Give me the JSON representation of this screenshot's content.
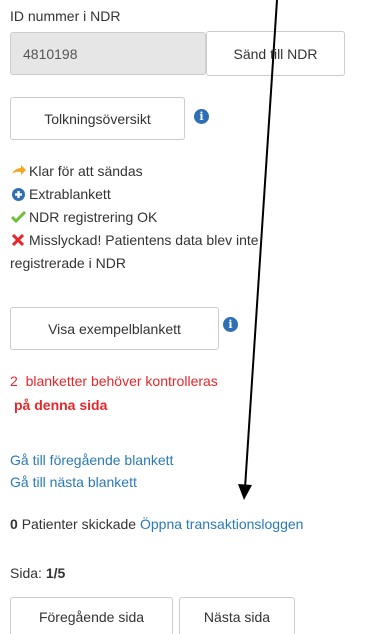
{
  "ndr": {
    "id_label": "ID nummer i NDR",
    "id_value": "4810198",
    "send_button": "Sänd till NDR"
  },
  "interpretation": {
    "button": "Tolkningsöversikt",
    "info_icon": "info-circle-icon"
  },
  "legend": {
    "ready": "Klar för att sändas",
    "extra": "Extrablankett",
    "ok": "NDR registrering OK",
    "failed_line1": "Misslyckad! Patientens data blev inte",
    "failed_line2": "registrerade i NDR"
  },
  "example": {
    "button": "Visa exempelblankett",
    "info_icon": "info-circle-icon"
  },
  "warning": {
    "count": "2",
    "line1_rest": "blanketter behöver kontrolleras",
    "line2": "på denna sida"
  },
  "navigation": {
    "prev_form": "Gå till föregående blankett",
    "next_form": "Gå till nästa blankett"
  },
  "transactions": {
    "count": "0",
    "sent_text": "Patienter skickade",
    "log_link": "Öppna transaktionsloggen"
  },
  "pagination": {
    "label": "Sida:",
    "value": "1/5",
    "prev_page": "Föregående sida",
    "next_page": "Nästa sida"
  },
  "colors": {
    "ready_arrow": "#f5a623",
    "extra_icon": "#2f6fb5",
    "ok_check": "#6fbf3a",
    "failed_x": "#e8262a",
    "link": "#2a7ab8",
    "warning": "#e8262a"
  }
}
